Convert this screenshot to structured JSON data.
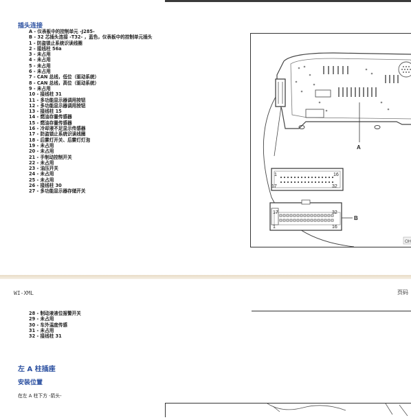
{
  "connector": {
    "title": "插头连接",
    "lines": [
      "A - 仪表板中的控制单元 -J285-",
      "B - 32 芯插头连接 -T32- ，蓝色，仪表板中的控制单元插头",
      "1 - 防盗锁止系统识读线圈",
      "2 - 接线柱 56a",
      "3 - 未占用",
      "4 - 未占用",
      "5 - 未占用",
      "6 - 未占用",
      "7 - CAN 总线，低位（驱动系统）",
      "8 - CAN 总线，高位（驱动系统）",
      "9 - 未占用",
      "10 - 接线柱 31",
      "11 - 多功能显示器调用按钮",
      "12 - 多功能显示器调用按钮",
      "13 - 接线柱 15",
      "14 - 燃油存量传感器",
      "15 - 燃油存量传感器",
      "16 - 冷却液不足显示传感器",
      "17 - 防盗锁止系统识读线圈",
      "18 - 后雾灯开关、后雾灯灯泡",
      "19 - 未占用",
      "20 - 未占用",
      "21 - 手制动控制开关",
      "22 - 未占用",
      "23 - 油压开关",
      "24 - 未占用",
      "25 - 未占用",
      "26 - 接线柱 30",
      "27 - 多功能显示器存储开关"
    ],
    "lines2": [
      "28 - 制动液液位报警开关",
      "29 - 未占用",
      "30 - 车外温度传感",
      "31 - 未占用",
      "32 - 接线柱 31"
    ]
  },
  "figure": {
    "label_a": "A",
    "label_b": "B",
    "pin_1": "1",
    "pin_16": "16",
    "pin_17": "17",
    "pin_32": "32",
    "code": "OH"
  },
  "page_header": {
    "left": "WI-XML",
    "right": "页码"
  },
  "section2": {
    "title": "左 A 柱插座",
    "subtitle": "安装位置",
    "paragraph": "在左 A 柱下方 -箭头-"
  }
}
